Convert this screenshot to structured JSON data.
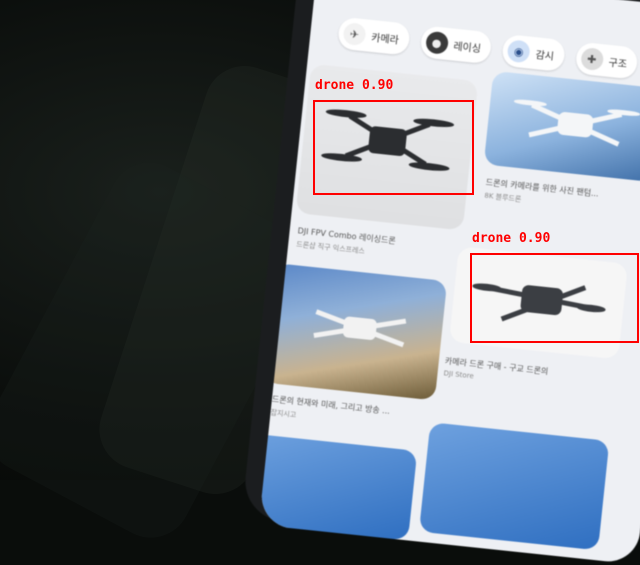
{
  "app": {
    "category_chips": [
      {
        "label": "카메라",
        "icon": "drone-icon"
      },
      {
        "label": "레이싱",
        "icon": "racing-drone-icon"
      },
      {
        "label": "감시",
        "icon": "surveillance-icon"
      },
      {
        "label": "구조",
        "icon": "rescue-icon"
      }
    ],
    "products": [
      {
        "title": "DJI FPV Combo 레이싱드론",
        "subtitle": "드론샵 직구 익스프레스",
        "image": "fpv-drone-photo"
      },
      {
        "title": "드론의 카메라를 위한 사진 팬텀...",
        "subtitle": "8K 블루드론",
        "image": "white-drone-sky-photo"
      },
      {
        "title": "드론의 현재와 미래, 그리고 방송 ...",
        "subtitle": "잡지시고",
        "image": "drone-smoke-photo"
      },
      {
        "title": "카메라 드론 구매 - 구교 드론의",
        "subtitle": "DJI Store",
        "image": "grey-folding-drone-photo"
      }
    ]
  },
  "detections": [
    {
      "label": "drone",
      "score": "0.90"
    },
    {
      "label": "drone",
      "score": "0.90"
    }
  ],
  "colors": {
    "detection": "#ff0000",
    "screen_background": "#eef0f4"
  }
}
